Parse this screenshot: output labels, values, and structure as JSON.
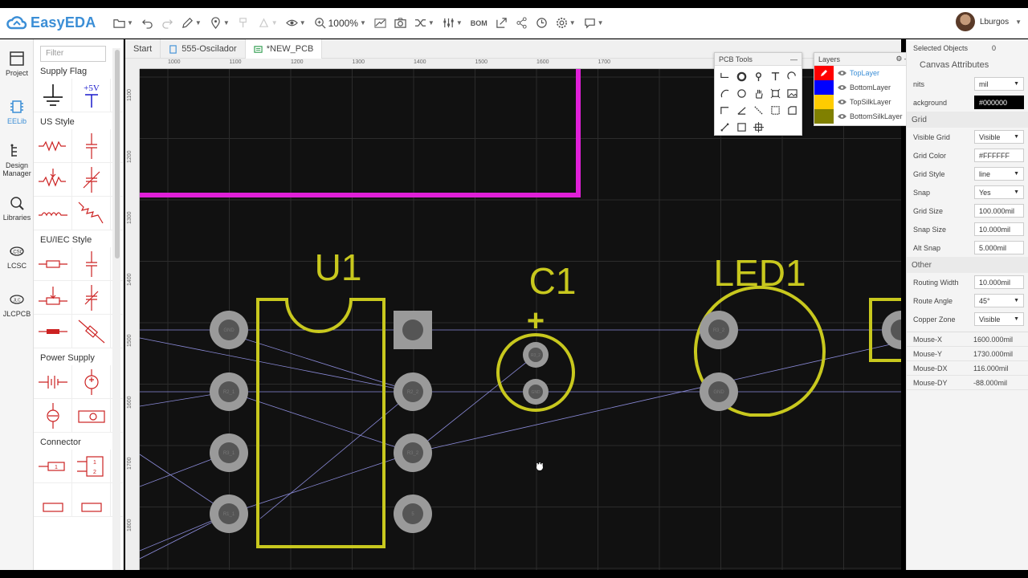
{
  "app": {
    "name": "EasyEDA"
  },
  "toolbar": {
    "zoom": "1000%",
    "bom_label": "BOM"
  },
  "user": {
    "name": "Lburgos"
  },
  "left_nav": [
    {
      "label": "Project"
    },
    {
      "label": "EELib"
    },
    {
      "label": "Design Manager"
    },
    {
      "label": "Libraries"
    },
    {
      "label": "LCSC"
    },
    {
      "label": "JLCPCB"
    }
  ],
  "library": {
    "filter_placeholder": "Filter",
    "categories": [
      "Supply Flag",
      "US Style",
      "EU/IEC Style",
      "Power Supply",
      "Connector"
    ],
    "vcc_label": "+5V"
  },
  "tabs": [
    {
      "label": "Start"
    },
    {
      "label": "555-Oscilador"
    },
    {
      "label": "*NEW_PCB"
    }
  ],
  "ruler": {
    "top": [
      "1000",
      "1100",
      "1200",
      "1300",
      "1400",
      "1500",
      "1600",
      "1700"
    ],
    "left": [
      "1100",
      "1200",
      "1300",
      "1400",
      "1500",
      "1600",
      "1700",
      "1800"
    ]
  },
  "pcb": {
    "designators": [
      "U1",
      "C1",
      "LED1"
    ],
    "c1_polarity": "+",
    "pads_left": [
      "GND",
      "R2_1",
      "R3_1",
      "R1_1"
    ],
    "pads_right": [
      "",
      "R2_2",
      "R3_2",
      "5"
    ],
    "c1_pads": [
      "R3_2",
      "GND"
    ],
    "led_pads": [
      "R3_2",
      "GND"
    ]
  },
  "pcb_tools": {
    "title": "PCB Tools"
  },
  "layers": {
    "title": "Layers",
    "items": [
      {
        "name": "TopLayer",
        "color": "#FF0000",
        "active": true
      },
      {
        "name": "BottomLayer",
        "color": "#0000FF",
        "active": false
      },
      {
        "name": "TopSilkLayer",
        "color": "#FFCC00",
        "active": false
      },
      {
        "name": "BottomSilkLayer",
        "color": "#808000",
        "active": false
      }
    ]
  },
  "props": {
    "selected_label": "Selected Objects",
    "selected_count": "0",
    "canvas_title": "Canvas Attributes",
    "units_label": "nits",
    "units_value": "mil",
    "background_label": "ackground",
    "background_value": "#000000",
    "grid_title": "Grid",
    "visible_grid_label": "Visible Grid",
    "visible_grid_value": "Visible",
    "grid_color_label": "Grid Color",
    "grid_color_value": "#FFFFFF",
    "grid_style_label": "Grid Style",
    "grid_style_value": "line",
    "snap_label": "Snap",
    "snap_value": "Yes",
    "grid_size_label": "Grid Size",
    "grid_size_value": "100.000mil",
    "snap_size_label": "Snap Size",
    "snap_size_value": "10.000mil",
    "alt_snap_label": "Alt Snap",
    "alt_snap_value": "5.000mil",
    "other_title": "Other",
    "routing_width_label": "Routing Width",
    "routing_width_value": "10.000mil",
    "route_angle_label": "Route Angle",
    "route_angle_value": "45°",
    "copper_zone_label": "Copper Zone",
    "copper_zone_value": "Visible",
    "mouse_x_label": "Mouse-X",
    "mouse_x_value": "1600.000mil",
    "mouse_y_label": "Mouse-Y",
    "mouse_y_value": "1730.000mil",
    "mouse_dx_label": "Mouse-DX",
    "mouse_dx_value": "116.000mil",
    "mouse_dy_label": "Mouse-DY",
    "mouse_dy_value": "-88.000mil"
  }
}
